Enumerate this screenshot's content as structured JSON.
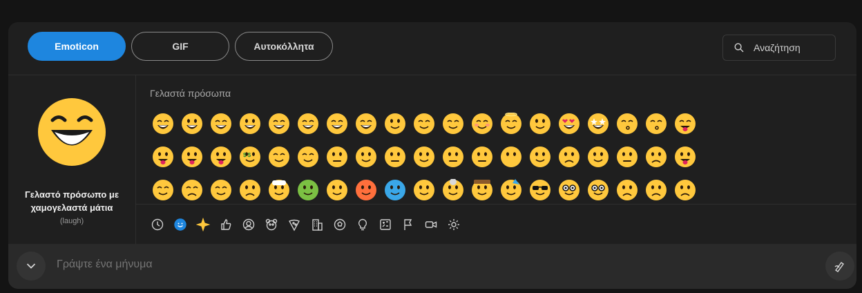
{
  "tabs": [
    {
      "label": "Emoticon",
      "active": true
    },
    {
      "label": "GIF",
      "active": false
    },
    {
      "label": "Αυτοκόλλητα",
      "active": false
    }
  ],
  "search": {
    "placeholder": "Αναζήτηση",
    "icon": "search-icon"
  },
  "preview": {
    "name_line1": "Γελαστό πρόσωπο με",
    "name_line2": "χαμογελαστά μάτια",
    "code": "(laugh)"
  },
  "section_title": "Γελαστά πρόσωπα",
  "emoji_rows": [
    [
      "laugh",
      "grin",
      "smile-teeth",
      "big-grin",
      "squint-laugh",
      "sweat-smile",
      "rofl",
      "tears-joy",
      "smile",
      "upside-down",
      "wink",
      "blush",
      "halo",
      "devil-smile",
      "heart-eyes",
      "star-struck",
      "kiss",
      "whistle",
      "yum"
    ],
    [
      "tongue",
      "tongue-wink",
      "zany",
      "money-mouth",
      "hug",
      "hand-over-mouth",
      "zipper",
      "eyes-up",
      "nervous",
      "raised-brow",
      "neutral",
      "expressionless",
      "no-mouth",
      "smirk",
      "unamused",
      "eye-roll",
      "grimace",
      "confused",
      "drool"
    ],
    [
      "relieved",
      "pensive",
      "sleepy",
      "sick",
      "bandage",
      "nauseated",
      "sneeze",
      "hot",
      "cold",
      "woozy",
      "exploding",
      "cowboy",
      "party",
      "cool",
      "nerd",
      "monocle",
      "worried",
      "frown",
      "sad"
    ]
  ],
  "categories": [
    "clock-icon",
    "smiley-icon",
    "sparkle-icon",
    "thumbs-up-icon",
    "person-icon",
    "animal-icon",
    "food-icon",
    "building-icon",
    "sports-ball-icon",
    "lightbulb-icon",
    "symbols-icon",
    "flag-icon",
    "video-icon",
    "gear-icon"
  ],
  "compose": {
    "placeholder": "Γράψτε ένα μήνυμα"
  },
  "colors": {
    "accent": "#1e86df",
    "panel": "#1f1f1f",
    "emoji_yellow": "#ffc83d"
  }
}
